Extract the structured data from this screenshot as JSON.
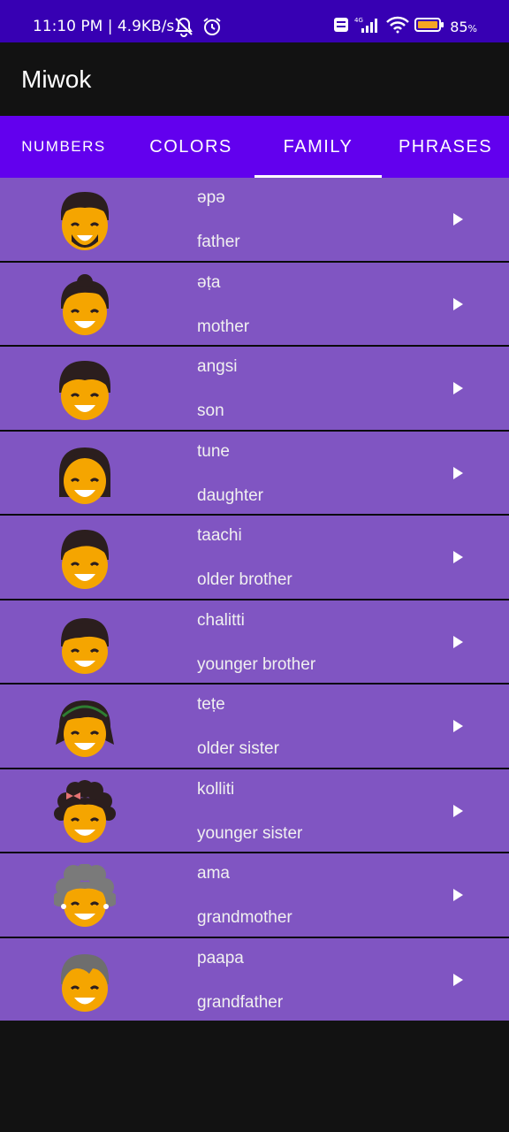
{
  "status_bar": {
    "time": "11:10 PM | 4.9KB/s",
    "battery": "85",
    "battery_unit": "%",
    "network": "4G",
    "volte": "Vo LTE",
    "icons": [
      "mute-icon",
      "alarm-icon",
      "volte-icon",
      "signal-icon",
      "wifi-icon",
      "battery-icon"
    ]
  },
  "app_bar": {
    "title": "Miwok"
  },
  "tabs": [
    {
      "label": "NUMBERS",
      "active": false
    },
    {
      "label": "COLORS",
      "active": false
    },
    {
      "label": "FAMILY",
      "active": true
    },
    {
      "label": "PHRASES",
      "active": false
    }
  ],
  "colors": {
    "status_bar": "#3700b3",
    "tab_bar": "#6200ee",
    "row_bg": "#8055c2",
    "background": "#121212"
  },
  "family": [
    {
      "miwok": "əpə",
      "english": "father",
      "icon": "father-icon"
    },
    {
      "miwok": "əṭa",
      "english": "mother",
      "icon": "mother-icon"
    },
    {
      "miwok": "angsi",
      "english": "son",
      "icon": "son-icon"
    },
    {
      "miwok": "tune",
      "english": "daughter",
      "icon": "daughter-icon"
    },
    {
      "miwok": "taachi",
      "english": "older brother",
      "icon": "older-brother-icon"
    },
    {
      "miwok": "chalitti",
      "english": "younger brother",
      "icon": "younger-brother-icon"
    },
    {
      "miwok": "teṭe",
      "english": "older sister",
      "icon": "older-sister-icon"
    },
    {
      "miwok": "kolliti",
      "english": "younger sister",
      "icon": "younger-sister-icon"
    },
    {
      "miwok": "ama",
      "english": "grandmother",
      "icon": "grandmother-icon"
    },
    {
      "miwok": "paapa",
      "english": "grandfather",
      "icon": "grandfather-icon"
    }
  ]
}
